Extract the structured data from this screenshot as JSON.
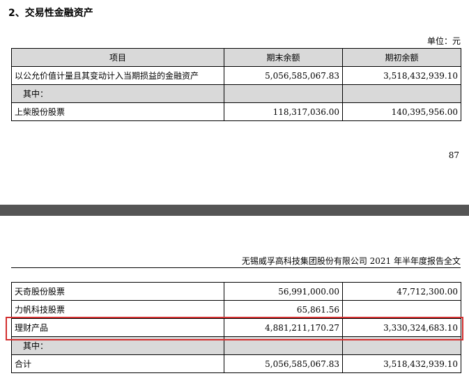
{
  "section_heading": "2、交易性金融资产",
  "unit_label": "单位：元",
  "table1": {
    "headers": [
      "项目",
      "期末余额",
      "期初余额"
    ],
    "rows": [
      {
        "item": "以公允价值计量且其变动计入当期损益的金融资产",
        "end": "5,056,585,067.83",
        "begin": "3,518,432,939.10"
      },
      {
        "item": "其中：",
        "end": "",
        "begin": ""
      },
      {
        "item": "上柴股份股票",
        "end": "118,317,036.00",
        "begin": "140,395,956.00"
      }
    ]
  },
  "page_number": "87",
  "doc_title": "无锡威孚高科技集团股份有限公司 2021 年半年度报告全文",
  "table2": {
    "rows": [
      {
        "item": "天奇股份股票",
        "end": "56,991,000.00",
        "begin": "47,712,300.00"
      },
      {
        "item": "力帆科技股票",
        "end": "65,861.56",
        "begin": ""
      },
      {
        "item": "理财产品",
        "end": "4,881,211,170.27",
        "begin": "3,330,324,683.10"
      },
      {
        "item": "其中：",
        "end": "",
        "begin": ""
      },
      {
        "item": "合计",
        "end": "5,056,585,067.83",
        "begin": "3,518,432,939.10"
      }
    ]
  },
  "highlight_color": "#d32f2f"
}
